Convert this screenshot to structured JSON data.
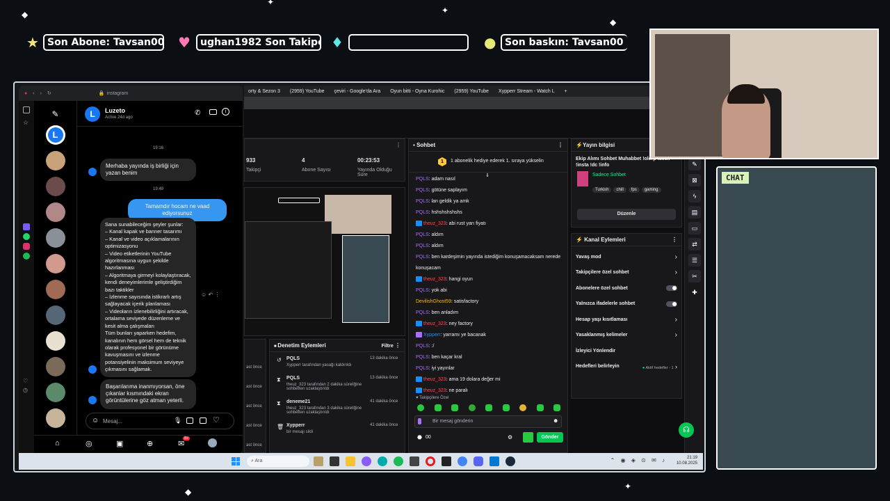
{
  "overlay": {
    "sub_label": "Son Abone: Tavsan00",
    "follower_label": "ughan1982    Son Takipçi: ",
    "donation_label": "",
    "raid_label": "Son baskın: Tavsan00",
    "chat_label": "CHAT"
  },
  "browser": {
    "ig_url": "instagram",
    "tabs": [
      "orty & Sezon 3",
      "(2959) YouTube",
      "çeviri - Google'da Ara",
      "Oyun bitti - Oyna Kurohic",
      "(2959) YouTube",
      "Xypperr Stream - Watch L"
    ]
  },
  "instagram": {
    "contact_name": "Luzeto",
    "contact_status": "Active 24d ago",
    "time1": "19:16",
    "time2": "19:49",
    "msg1": "Merhaba yayında iş birliği için yazan benim",
    "msg_sent": "Tamamdır hocam ne vaad ediyorsunuz",
    "msg2": "Sana sunabileceğim şeyler şunlar:\n– Kanal kapak ve banner tasarımı\n– Kanal ve video açıklamalarının optimizasyonu\n– Video etiketlerinin YouTube algoritmasına uygun şekilde hazırlanması\n– Algoritmaya girmeyi kolaylaştıracak, kendi deneyimlerimle geliştirdiğim bazı taktikler\n– İzlenme sayısında istikrarlı artış sağlayacak içerik planlaması\n– Videoların izlenebilirliğini artıracak, ortalama seviyede düzenleme ve kesit alma çalışmaları\nTüm bunları yaparken hedefim, kanalının hem görsel hem de teknik olarak profesyonel bir görünüme kavuşmasını ve izlenme potansiyelinin maksimum seviyeye çıkmasını sağlamak.",
    "msg3": "Başarılarıma inanmıyorsan, öne çıkanlar kısmındaki ekran görüntülerine göz atman yeterli.",
    "input_placeholder": "Mesaj...",
    "nav_badge": "9+"
  },
  "dashboard": {
    "stats": [
      {
        "value": "933",
        "label": "Takipçi"
      },
      {
        "value": "4",
        "label": "Abone Sayısı"
      },
      {
        "value": "00:23:53",
        "label": "Yayında Olduğu Süre"
      }
    ],
    "chat_title": "Sohbet",
    "hype_text": "1 abonelik hediye ederek 1. sıraya yükselin",
    "hype_rank": "1",
    "chat_messages": [
      {
        "user": "PQLS",
        "text": "adam nasıl",
        "cls": "u1"
      },
      {
        "user": "PQLS",
        "text": "götüne saplayım",
        "cls": "u1"
      },
      {
        "user": "PQLS",
        "text": "lan geldik ya amk",
        "cls": "u1"
      },
      {
        "user": "PQLS",
        "text": "hshshshshshs",
        "cls": "u1"
      },
      {
        "user": "theuz_323",
        "text": "abi rust yarı fiyatı",
        "cls": "u2"
      },
      {
        "user": "PQLS",
        "text": "aldım",
        "cls": "u1"
      },
      {
        "user": "PQLS",
        "text": "aldım",
        "cls": "u1"
      },
      {
        "user": "PQLS",
        "text": "ben kardeşimin yayında istediğim konuşamacaksam nerede",
        "cls": "u1"
      },
      {
        "user": "",
        "text": "konuşacam",
        "cls": "u1"
      },
      {
        "user": "theuz_323",
        "text": "hangi oyun",
        "cls": "u2"
      },
      {
        "user": "PQLS",
        "text": "yok abi",
        "cls": "u1"
      },
      {
        "user": "DevilishGhost59",
        "text": "satisfactory",
        "cls": "u3"
      },
      {
        "user": "PQLS",
        "text": "ben anladım",
        "cls": "u1"
      },
      {
        "user": "theuz_323",
        "text": "ney factory",
        "cls": "u2"
      },
      {
        "user": "Xypperr",
        "text": "yarramı ye bacanak",
        "cls": "u1"
      },
      {
        "user": "PQLS",
        "text": ":/",
        "cls": "u1"
      },
      {
        "user": "PQLS",
        "text": "ben kaçar kral",
        "cls": "u1"
      },
      {
        "user": "PQLS",
        "text": "iyi yayınlar",
        "cls": "u1"
      },
      {
        "user": "theuz_323",
        "text": "ama 19 dolara değer mi",
        "cls": "u2"
      },
      {
        "user": "theuz_323",
        "text": "ne paralı",
        "cls": "u2"
      }
    ],
    "followers_only": "Takipçilere Özel",
    "send_placeholder": "Bir mesaj gönderin",
    "send_button": "Gönder",
    "points": "00",
    "stream_info_title": "Yayın bilgisi",
    "stream_title": "Ekip Alımı Sohbet Muhabbet !olerp !sesli !insta !dc !info",
    "category": "Sadece Sohbet",
    "tags": [
      "Turkish",
      "chill",
      "fps",
      "gaming"
    ],
    "edit_button": "Düzenle",
    "actions_title": "Kanal Eylemleri",
    "actions": [
      {
        "label": "Yavaş mod",
        "kind": "chevron"
      },
      {
        "label": "Takipçilere özel sohbet",
        "kind": "chevron"
      },
      {
        "label": "Abonelere özel sohbet",
        "kind": "toggle"
      },
      {
        "label": "Yalnızca ifadelerle sohbet",
        "kind": "toggle"
      },
      {
        "label": "Hesap yaşı kısıtlaması",
        "kind": "chevron"
      },
      {
        "label": "Yasaklanmış kelimeler",
        "kind": "chevron"
      },
      {
        "label": "İzleyici Yönlendir",
        "kind": "none"
      },
      {
        "label": "Hedefleri belirleyin",
        "kind": "goal"
      }
    ],
    "goal_note": "Aktif hedefler - 1",
    "mod_title": "Denetim Eylemleri",
    "mod_filter": "Filtre",
    "mod_actions": [
      {
        "user": "PQLS",
        "detail": "Xypperr tarafından yasağı kaldırıldı",
        "when": "13 dakika önce"
      },
      {
        "user": "PQLS",
        "detail": "theuz_323 tarafından 2 dakika süreliğine sohbetten uzaklaştırıldı",
        "when": "13 dakika önce"
      },
      {
        "user": "deneme21",
        "detail": "theuz_323 tarafından 3 dakika süreliğine sohbetten uzaklaştırıldı",
        "when": "41 dakika önce"
      },
      {
        "user": "Xypperr",
        "detail": "bir mesajı sildi",
        "when": "41 dakika önce"
      }
    ],
    "mod_left_times": [
      "ast önce",
      "ast önce",
      "ast önce",
      "ast önce",
      "ast önce"
    ]
  },
  "taskbar": {
    "search": "Ara",
    "time": "21:19",
    "date": "10.08.2025"
  }
}
